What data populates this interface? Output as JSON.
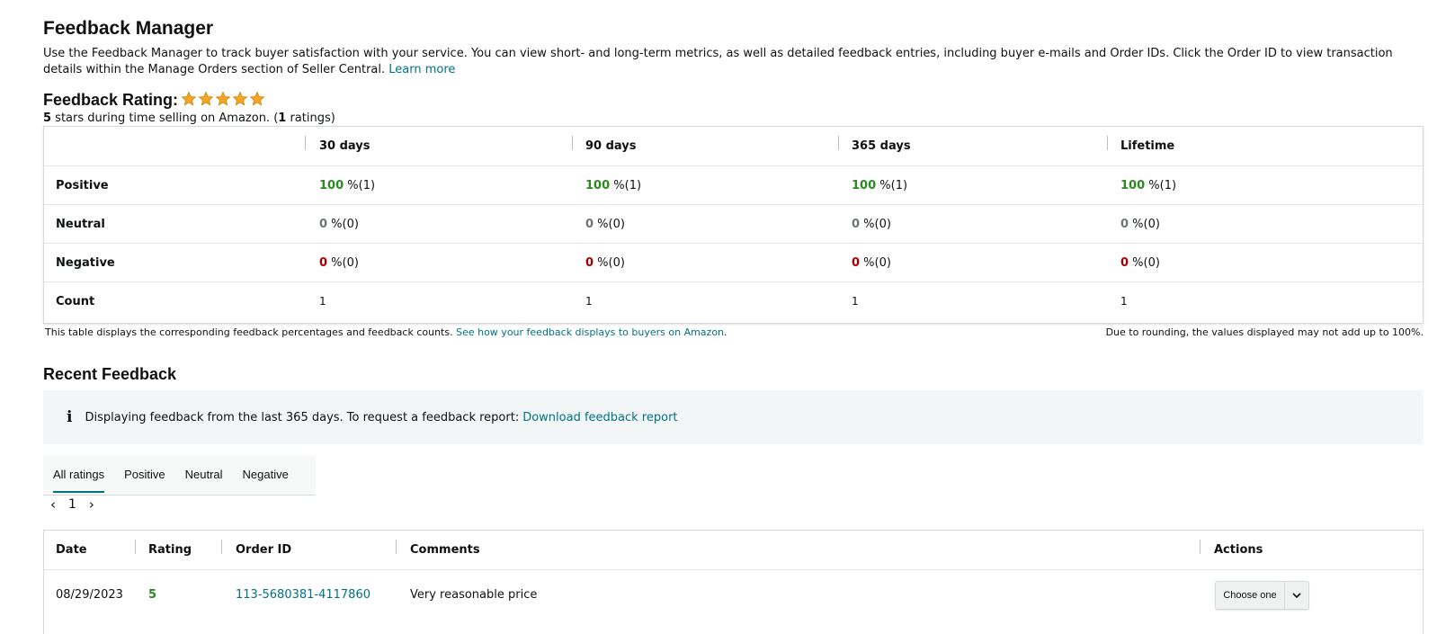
{
  "header": {
    "title": "Feedback Manager",
    "description": "Use the Feedback Manager to track buyer satisfaction with your service. You can view short- and long-term metrics, as well as detailed feedback entries, including buyer e-mails and Order IDs. Click the Order ID to view transaction details within the Manage Orders section of Seller Central.",
    "learn_more": "Learn more"
  },
  "rating": {
    "title": "Feedback Rating:",
    "stars": 5,
    "star_color": "#f5a623",
    "stars_value": "5",
    "sub_text": " stars during time selling on Amazon. (",
    "ratings_count": "1",
    "sub_tail": " ratings)"
  },
  "metrics": {
    "columns": [
      "30 days",
      "90 days",
      "365 days",
      "Lifetime"
    ],
    "rows": [
      {
        "label": "Positive",
        "cells": [
          {
            "pct": "100",
            "count": " %(1)"
          },
          {
            "pct": "100",
            "count": " %(1)"
          },
          {
            "pct": "100",
            "count": " %(1)"
          },
          {
            "pct": "100",
            "count": " %(1)"
          }
        ]
      },
      {
        "label": "Neutral",
        "cells": [
          {
            "pct": "0",
            "count": " %(0)"
          },
          {
            "pct": "0",
            "count": " %(0)"
          },
          {
            "pct": "0",
            "count": " %(0)"
          },
          {
            "pct": "0",
            "count": " %(0)"
          }
        ]
      },
      {
        "label": "Negative",
        "cells": [
          {
            "pct": "0",
            "count": " %(0)"
          },
          {
            "pct": "0",
            "count": " %(0)"
          },
          {
            "pct": "0",
            "count": " %(0)"
          },
          {
            "pct": "0",
            "count": " %(0)"
          }
        ]
      },
      {
        "label": "Count",
        "cells": [
          {
            "pct": "",
            "count": "1"
          },
          {
            "pct": "",
            "count": "1"
          },
          {
            "pct": "",
            "count": "1"
          },
          {
            "pct": "",
            "count": "1"
          }
        ]
      }
    ],
    "note_left": "This table displays the corresponding feedback percentages and feedback counts. ",
    "note_link": "See how your feedback displays to buyers on Amazon",
    "note_dot": ".",
    "note_right": "Due to rounding, the values displayed may not add up to 100%."
  },
  "recent": {
    "title": "Recent Feedback",
    "info_icon": "i",
    "info_text": "Displaying feedback from the last 365 days. To request a feedback report: ",
    "info_link": "Download feedback report",
    "tabs": [
      "All ratings",
      "Positive",
      "Neutral",
      "Negative"
    ],
    "page": "1",
    "prev": "‹",
    "next": "›",
    "columns": [
      "Date",
      "Rating",
      "Order ID",
      "Comments",
      "Actions"
    ],
    "rows": [
      {
        "date": "08/29/2023",
        "rating": "5",
        "order_id": "113-5680381-4117860",
        "comment": "Very reasonable price",
        "action": "Choose one"
      }
    ]
  }
}
